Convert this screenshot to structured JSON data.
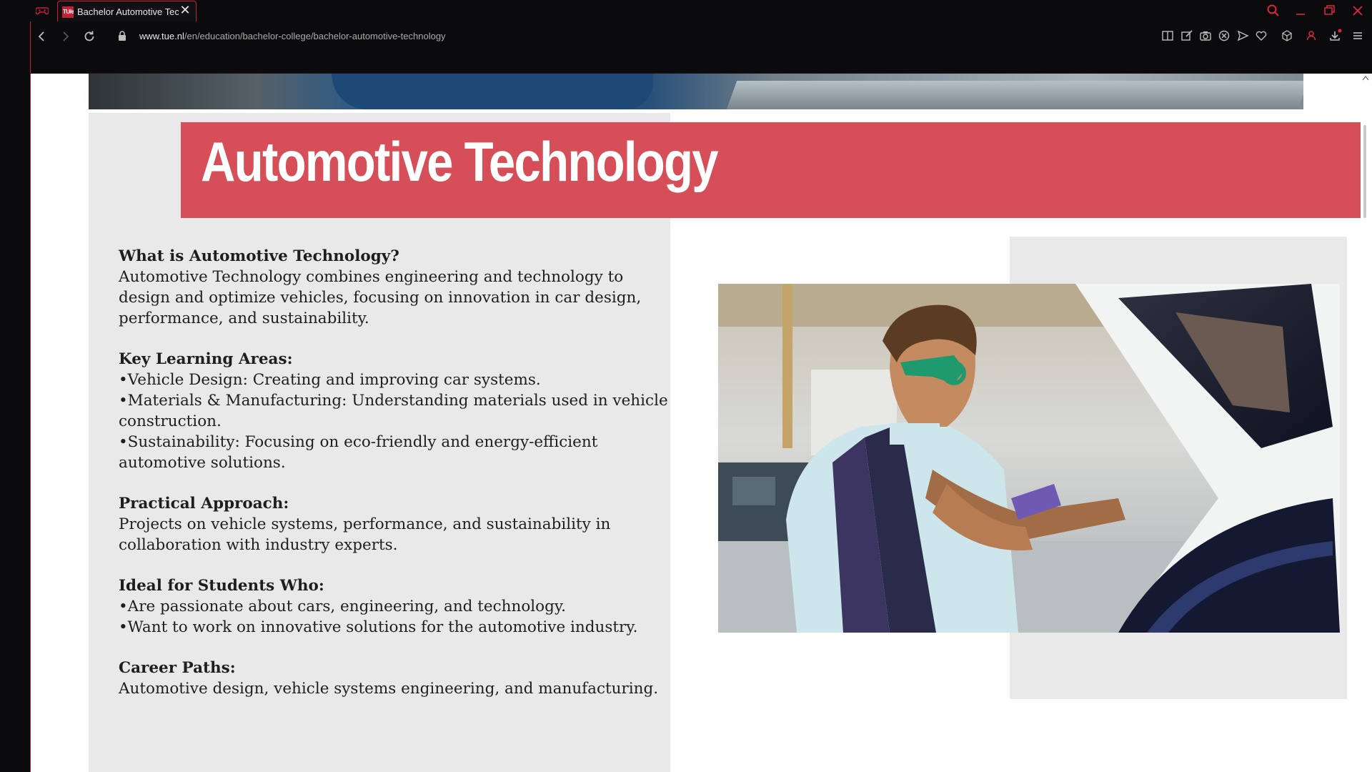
{
  "browser": {
    "tab_title": "Bachelor Automotive Technology | TU/e",
    "favicon_text": "TU/e",
    "tab_close_glyph": "✕",
    "url_host": "www.tue.nl",
    "url_path": "/en/education/bachelor-college/bachelor-automotive-technology",
    "accent_color": "#c8203a"
  },
  "page": {
    "title": "Automotive Technology",
    "title_band_color": "#d64f58",
    "sections": {
      "what": {
        "heading": "What is Automotive Technology?",
        "body": "Automotive Technology combines engineering and technology to design and optimize vehicles, focusing on innovation in car design, performance, and sustainability."
      },
      "learning": {
        "heading": "Key Learning Areas:",
        "items": [
          "•Vehicle Design: Creating and improving car systems.",
          "•Materials & Manufacturing: Understanding materials used in vehicle construction.",
          "•Sustainability: Focusing on eco-friendly and energy-efficient automotive solutions."
        ]
      },
      "practical": {
        "heading": "Practical Approach:",
        "body": "Projects on vehicle systems, performance, and sustainability in collaboration with industry experts."
      },
      "ideal": {
        "heading": "Ideal for Students Who:",
        "items": [
          "•Are passionate about cars, engineering, and technology.",
          "•Want to work on innovative solutions for the automotive industry."
        ]
      },
      "career": {
        "heading": "Career Paths:",
        "body": "Automotive design, vehicle systems engineering, and manufacturing."
      }
    }
  },
  "icons": {
    "game": "gamepad-icon",
    "back": "back-arrow-icon",
    "forward": "forward-arrow-icon",
    "reload": "reload-icon",
    "lock": "lock-icon",
    "search": "search-icon",
    "minimize": "minimize-icon",
    "restore": "restore-icon",
    "close": "close-icon"
  }
}
